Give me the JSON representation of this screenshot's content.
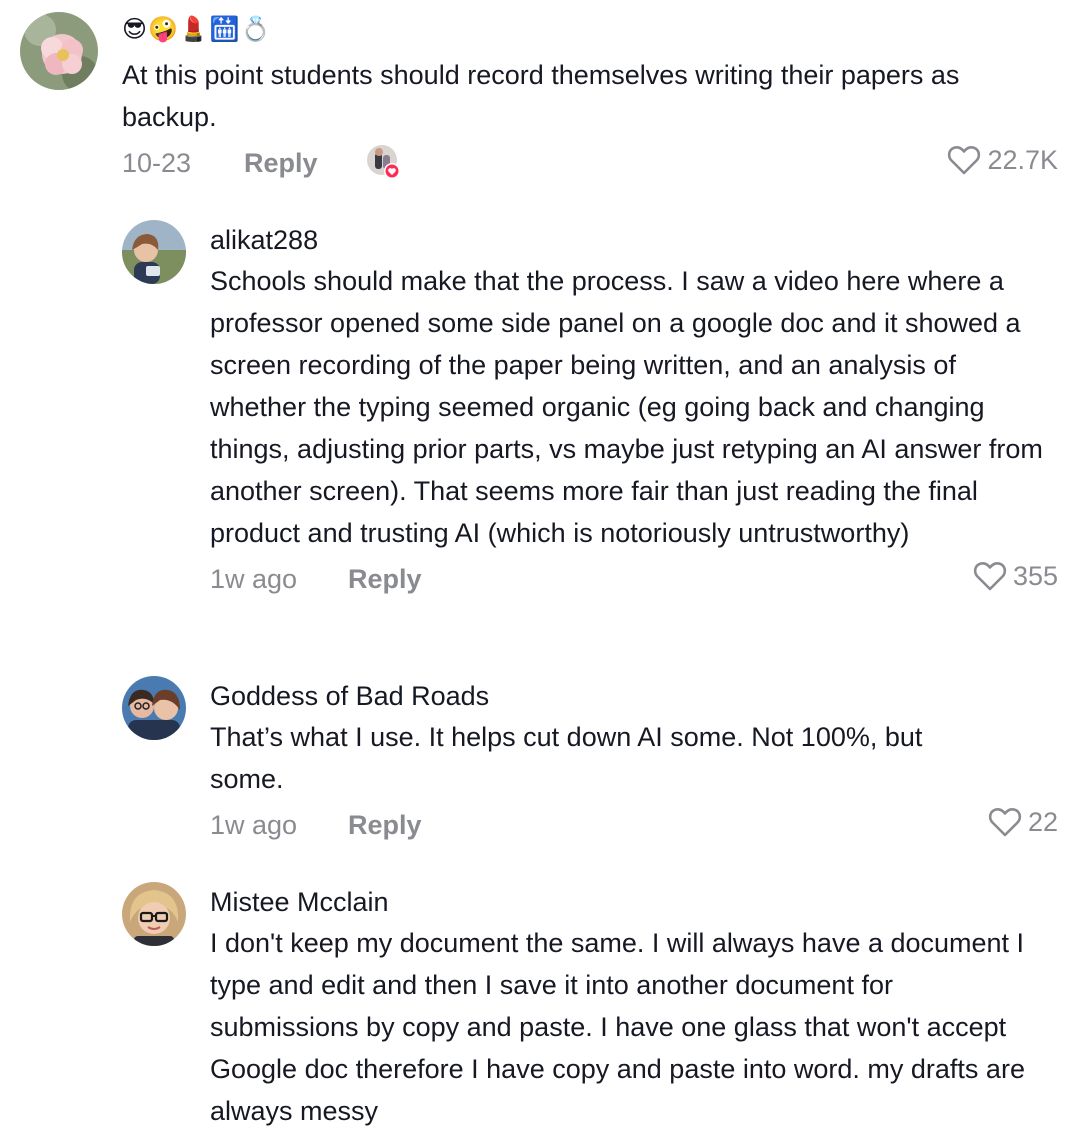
{
  "comments": [
    {
      "username": "😎🤪💄🛗💍",
      "text": "At this point students should record themselves writing their papers as backup.",
      "date": "10-23",
      "reply_label": "Reply",
      "likes": "22.7K"
    },
    {
      "username": "alikat288",
      "text": "Schools should make that the process. I saw a video here where a professor opened some side panel on a google doc and it showed a screen recording of the paper being written, and an analysis of whether the typing seemed organic (eg going back and changing things, adjusting prior parts, vs maybe just retyping an AI answer from another screen). That seems more fair than just reading the final product and trusting AI (which is notoriously untrustworthy)",
      "date": "1w ago",
      "reply_label": "Reply",
      "likes": "355"
    },
    {
      "username": "Goddess of Bad Roads",
      "text": "That’s what I use. It helps cut down AI some. Not 100%, but some.",
      "date": "1w ago",
      "reply_label": "Reply",
      "likes": "22"
    },
    {
      "username": "Mistee Mcclain",
      "text": "I don't keep my document the same. I will always have a document I type and edit and then I save it into another document for submissions by copy and paste. I have one glass that won't accept Google doc therefore I have copy and paste into word. my drafts are always messy"
    }
  ],
  "colors": {
    "text": "#161823",
    "muted": "#8a8b91",
    "liked_badge": "#fe2c55"
  },
  "icons": {
    "like": "heart-outline-icon",
    "creator_liked": "creator-liked-badge"
  }
}
